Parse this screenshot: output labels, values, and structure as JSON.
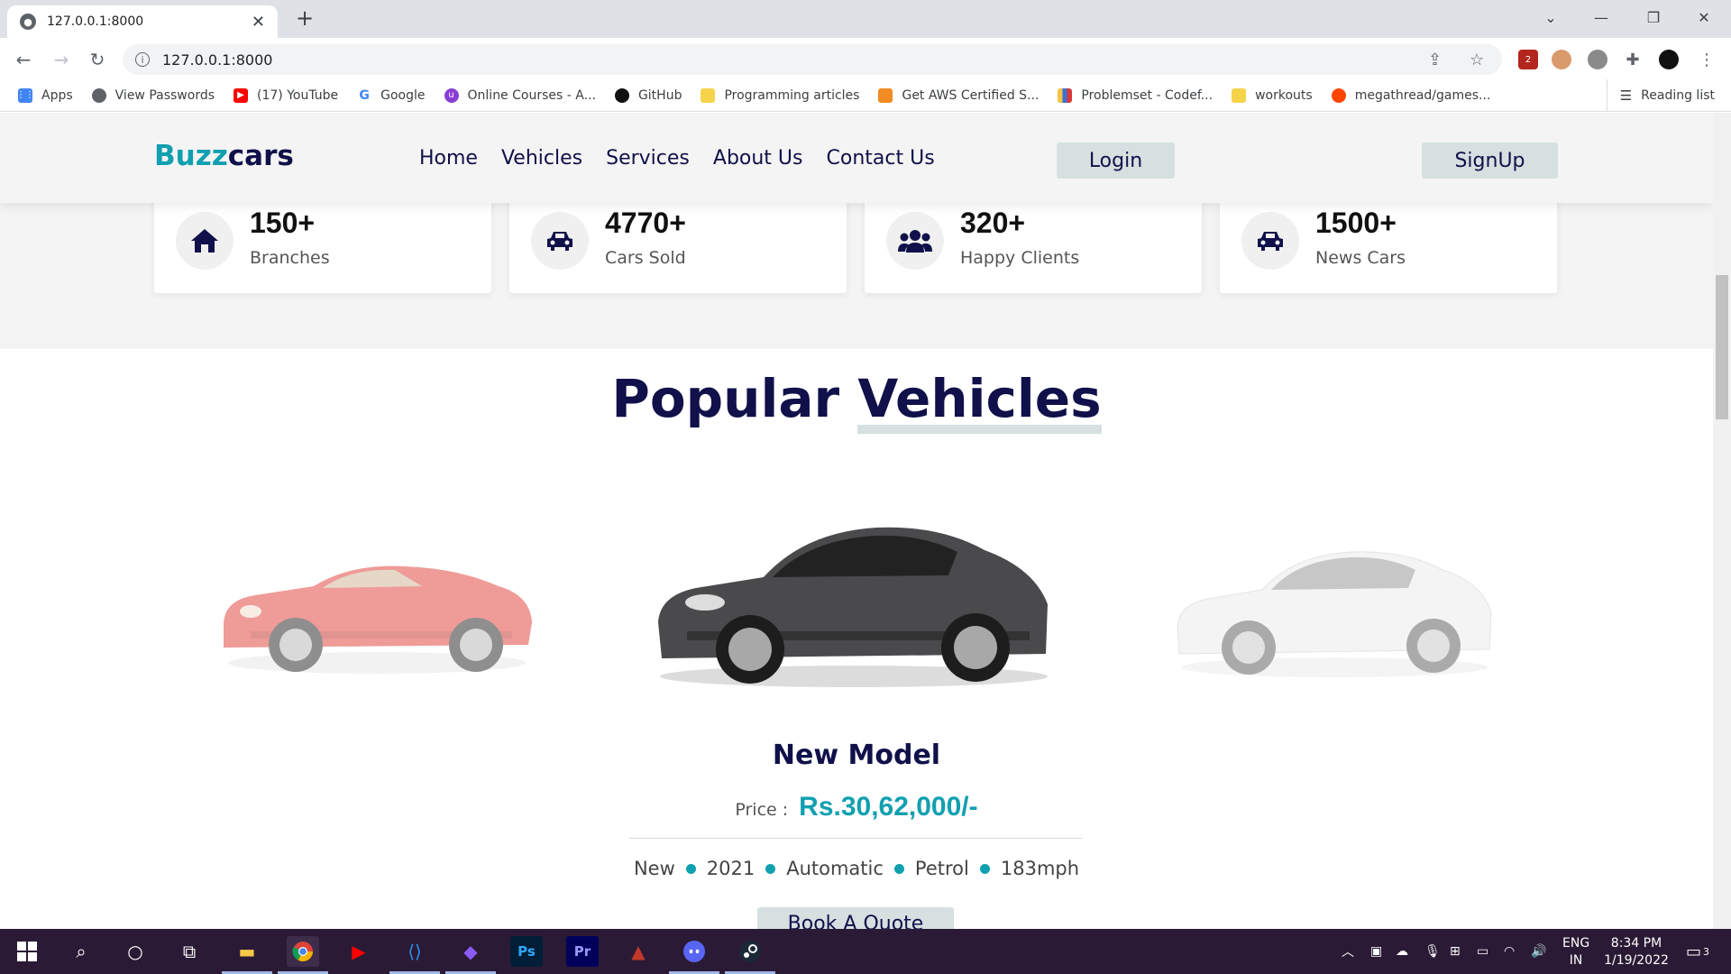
{
  "browser": {
    "tab_title": "127.0.0.1:8000",
    "url": "127.0.0.1:8000",
    "bookmarks": [
      {
        "label": "Apps",
        "color": "#4285f4"
      },
      {
        "label": "View Passwords",
        "color": "#5f6368"
      },
      {
        "label": "(17) YouTube",
        "color": "#ff0000"
      },
      {
        "label": "Google",
        "color": "#ffffff"
      },
      {
        "label": "Online Courses - A...",
        "color": "#8a3ed6"
      },
      {
        "label": "GitHub",
        "color": "#111111"
      },
      {
        "label": "Programming articles",
        "color": "#f5d44c"
      },
      {
        "label": "Get AWS Certified S...",
        "color": "#f28b22"
      },
      {
        "label": "Problemset - Codef...",
        "color": "#3a6fd8"
      },
      {
        "label": "workouts",
        "color": "#f5d44c"
      },
      {
        "label": "megathread/games...",
        "color": "#ff4500"
      }
    ],
    "reading_list": "Reading list",
    "extension_badge": "2"
  },
  "site": {
    "logo_part1": "Buzz",
    "logo_part2": "cars",
    "nav": {
      "home": "Home",
      "vehicles": "Vehicles",
      "services": "Services",
      "about": "About Us",
      "contact": "Contact Us"
    },
    "login": "Login",
    "signup": "SignUp",
    "colors": {
      "accent": "#10a0b0",
      "navy": "#10104a",
      "button_bg": "#d6e0e0"
    }
  },
  "stats": [
    {
      "value": "150+",
      "label": "Branches",
      "icon": "home-icon"
    },
    {
      "value": "4770+",
      "label": "Cars Sold",
      "icon": "car-icon"
    },
    {
      "value": "320+",
      "label": "Happy Clients",
      "icon": "users-icon"
    },
    {
      "value": "1500+",
      "label": "News Cars",
      "icon": "car-icon"
    }
  ],
  "popular": {
    "title_part1": "Popular",
    "title_part2": "Vehicles",
    "cars": [
      {
        "color": "#e24a45"
      },
      {
        "color": "#4a4a4c"
      },
      {
        "color": "#ececec"
      }
    ],
    "model_name": "New Model",
    "price_label": "Price :",
    "price": "Rs.30,62,000/-",
    "specs": [
      "New",
      "2021",
      "Automatic",
      "Petrol",
      "183mph"
    ],
    "book_label": "Book A Quote"
  },
  "taskbar": {
    "lang_top": "ENG",
    "lang_bottom": "IN",
    "time": "8:34 PM",
    "date": "1/19/2022",
    "notifications": "3"
  }
}
